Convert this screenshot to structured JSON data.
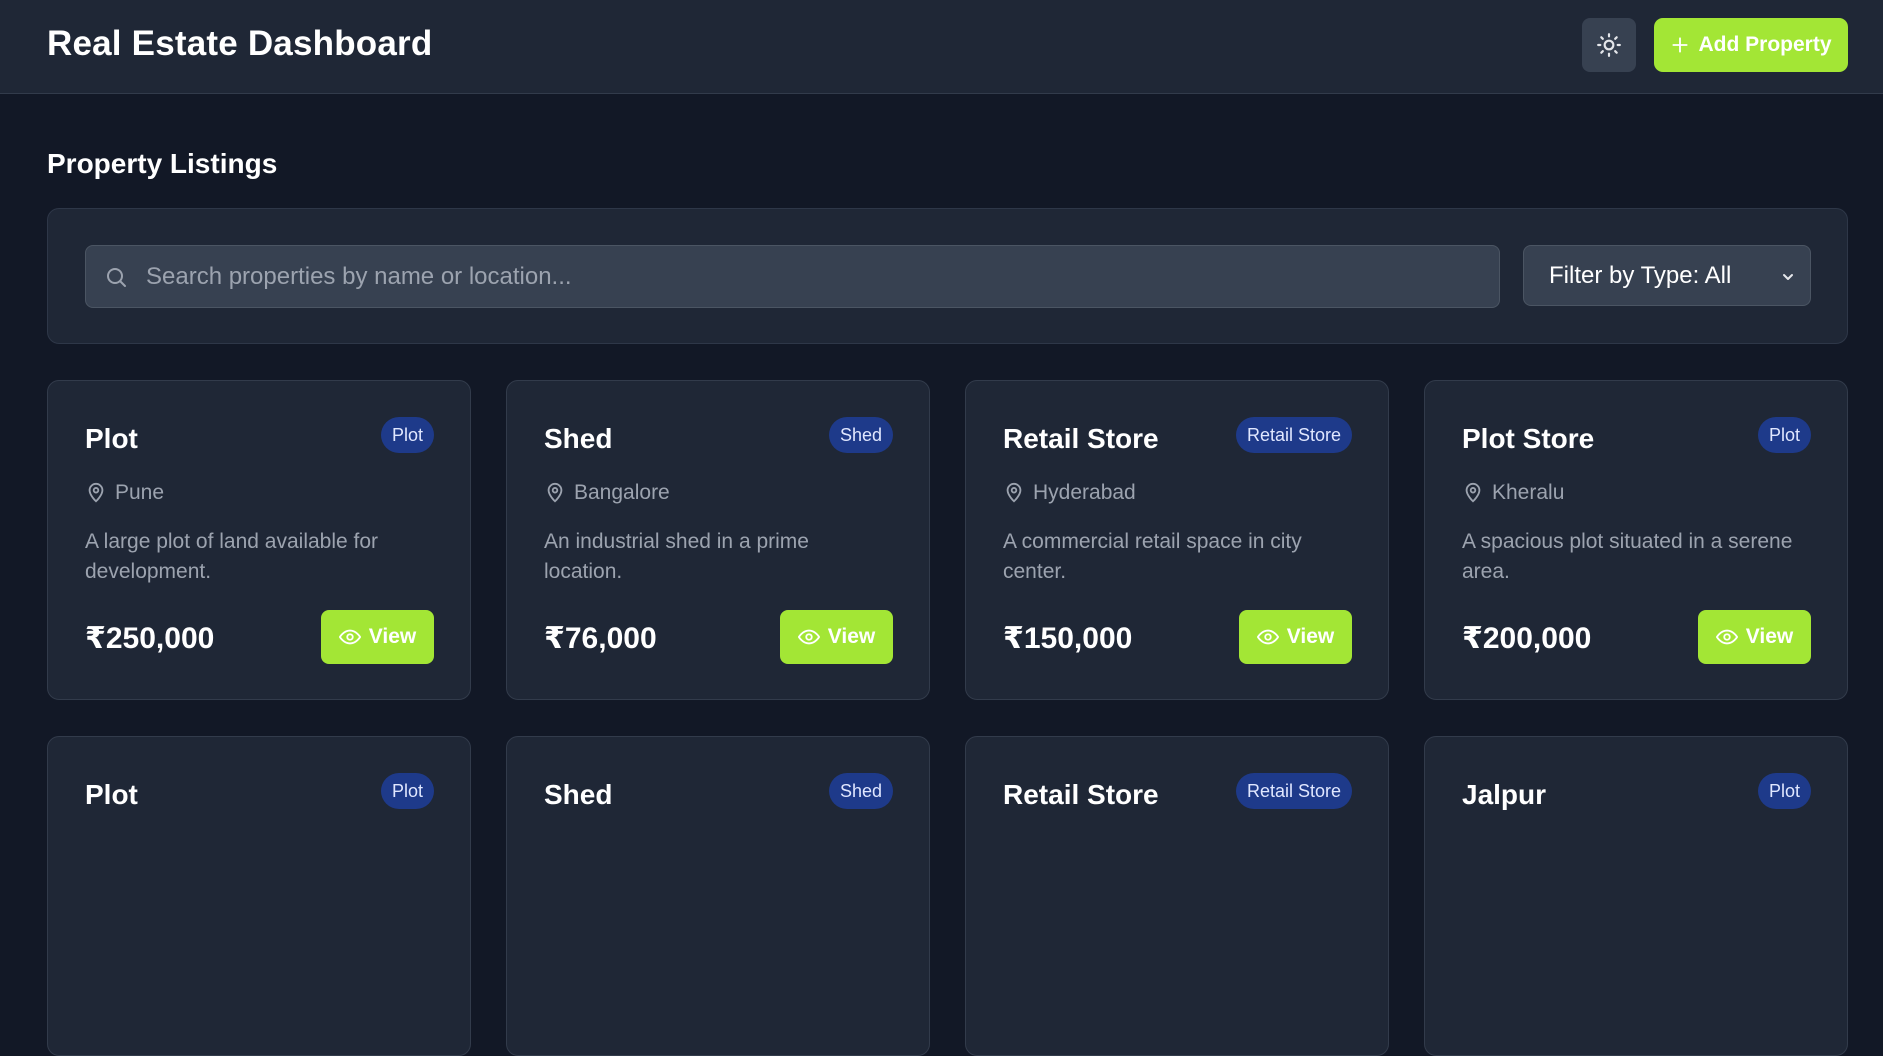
{
  "header": {
    "title": "Real Estate Dashboard",
    "add_button_label": "Add Property"
  },
  "main": {
    "section_title": "Property Listings",
    "search_placeholder": "Search properties by name or location...",
    "filter_label": "Filter by Type: All"
  },
  "colors": {
    "background": "#121826",
    "surface": "#1f2736",
    "accent": "#a3e635",
    "badge": "#1e3a8a"
  },
  "icons": {
    "theme": "sun-icon",
    "add": "plus-icon",
    "search": "search-icon",
    "location": "map-pin-icon",
    "view": "eye-icon",
    "dropdown": "chevron-down-icon"
  },
  "properties": [
    {
      "title": "Plot",
      "badge": "Plot",
      "location": "Pune",
      "description": "A large plot of land available for development.",
      "price": "₹250,000",
      "action": "View"
    },
    {
      "title": "Shed",
      "badge": "Shed",
      "location": "Bangalore",
      "description": "An industrial shed in a prime location.",
      "price": "₹76,000",
      "action": "View"
    },
    {
      "title": "Retail Store",
      "badge": "Retail Store",
      "location": "Hyderabad",
      "description": "A commercial retail space in city center.",
      "price": "₹150,000",
      "action": "View"
    },
    {
      "title": "Plot Store",
      "badge": "Plot",
      "location": "Kheralu",
      "description": "A spacious plot situated in a serene area.",
      "price": "₹200,000",
      "action": "View"
    },
    {
      "title": "Plot",
      "badge": "Plot"
    },
    {
      "title": "Shed",
      "badge": "Shed"
    },
    {
      "title": "Retail Store",
      "badge": "Retail Store"
    },
    {
      "title": "Jalpur",
      "badge": "Plot"
    }
  ]
}
